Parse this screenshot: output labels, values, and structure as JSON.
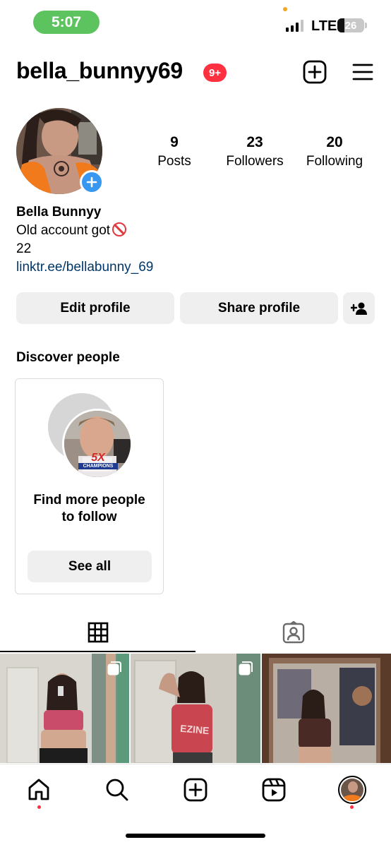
{
  "status_bar": {
    "time": "5:07",
    "network": "LTE",
    "battery": "26",
    "battery_level": 0.26
  },
  "header": {
    "username": "bella_bunnyy69",
    "notification_badge": "9+"
  },
  "profile": {
    "stats": [
      {
        "count": "9",
        "label": "Posts"
      },
      {
        "count": "23",
        "label": "Followers"
      },
      {
        "count": "20",
        "label": "Following"
      }
    ],
    "name": "Bella Bunnyy",
    "bio_line1": "Old account got",
    "bio_line2": "22",
    "link": "linktr.ee/bellabunny_69"
  },
  "actions": {
    "edit_profile": "Edit profile",
    "share_profile": "Share profile"
  },
  "discover": {
    "title": "Discover people",
    "card_text": "Find more people to follow",
    "see_all": "See all",
    "badge_main": "5X",
    "badge_sub": "CHAMPIONS"
  },
  "colors": {
    "accent_blue": "#3897f0",
    "link": "#00376b",
    "badge_red": "#ff3040",
    "button_bg": "#efefef",
    "time_pill": "#5cc35f"
  }
}
